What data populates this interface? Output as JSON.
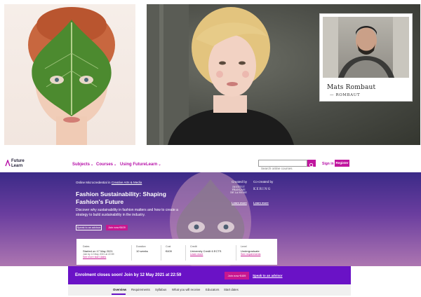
{
  "collage": {
    "inset_name": "Mats Rombaut",
    "inset_brand": "ROMBAUT"
  },
  "header": {
    "logo_line1": "Future",
    "logo_line2": "Learn",
    "nav": [
      "Subjects",
      "Courses",
      "Using FutureLearn"
    ],
    "search_placeholder": "Search online courses",
    "sign_in": "Sign in",
    "register": "Register"
  },
  "hero": {
    "crumb_prefix": "Online Microcredential in",
    "crumb_link": "Creative Arts & Media",
    "title": "Fashion Sustainability: Shaping Fashion's Future",
    "description": "Discover why sustainability in fashion matters and how to create a strategy to build sustainability in the industry.",
    "speak_advisor": "Speak to an advisor",
    "join_now": "Join now €409",
    "created_by_label": "Created by",
    "created_by_logo": "INSTITUT FRANÇAIS DE LA MODE",
    "co_created_label": "Co-created by",
    "co_created_logo": "KERING",
    "learn_more": "Learn more",
    "accent_color": "#c8178f",
    "gradient_top": "#3b2a87",
    "gradient_bottom": "#ad76b1"
  },
  "info": {
    "dates_label": "Dates",
    "dates_value": "Started on 17 May 2021",
    "dates_sub": "Join by 12 May 2021 at 22:59",
    "dates_link": "See more start dates",
    "duration_label": "Duration",
    "duration_value": "10 weeks",
    "cost_label": "Cost",
    "cost_value": "€409",
    "credit_label": "Credit",
    "credit_value": "University Credit 6 ECTS",
    "credit_link": "Learn more",
    "level_label": "Level",
    "level_value": "Undergraduate",
    "level_link": "See requirements"
  },
  "enrol": {
    "text": "Enrolment closes soon! Join by 12 May 2021 at 22:59",
    "button": "Join now €409",
    "advisor": "Speak to an advisor",
    "bar_color": "#6a12c6"
  },
  "tabs": [
    "Overview",
    "Requirements",
    "Syllabus",
    "What you will receive",
    "Educators",
    "Start dates"
  ],
  "active_tab": "Overview"
}
